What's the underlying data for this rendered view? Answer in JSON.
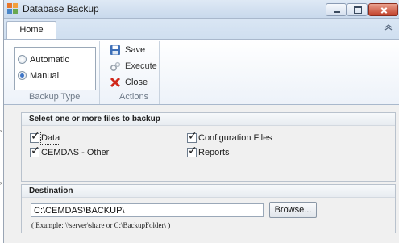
{
  "window": {
    "title": "Database Backup",
    "accent_close": "#c2412a"
  },
  "ribbon": {
    "tabs": [
      {
        "label": "Home",
        "selected": true
      }
    ],
    "backup_type": {
      "caption": "Backup Type",
      "options": [
        {
          "label": "Automatic",
          "checked": false
        },
        {
          "label": "Manual",
          "checked": true
        }
      ]
    },
    "actions": {
      "caption": "Actions",
      "items": [
        {
          "label": "Save",
          "icon": "save-icon",
          "enabled": true
        },
        {
          "label": "Execute",
          "icon": "execute-icon",
          "enabled": false
        },
        {
          "label": "Close",
          "icon": "close-x-icon",
          "enabled": true
        }
      ]
    }
  },
  "files_panel": {
    "header": "Select one or more files to backup",
    "checkboxes": [
      {
        "label": "Data",
        "checked": true,
        "focused": true
      },
      {
        "label": "Configuration Files",
        "checked": true,
        "focused": false
      },
      {
        "label": "CEMDAS - Other",
        "checked": true,
        "focused": false
      },
      {
        "label": "Reports",
        "checked": true,
        "focused": false
      }
    ]
  },
  "destination_panel": {
    "header": "Destination",
    "path_value": "C:\\CEMDAS\\BACKUP\\",
    "browse_label": "Browse...",
    "example_text": "( Example:  \\\\server\\share   or   C:\\BackupFolder\\ )"
  }
}
